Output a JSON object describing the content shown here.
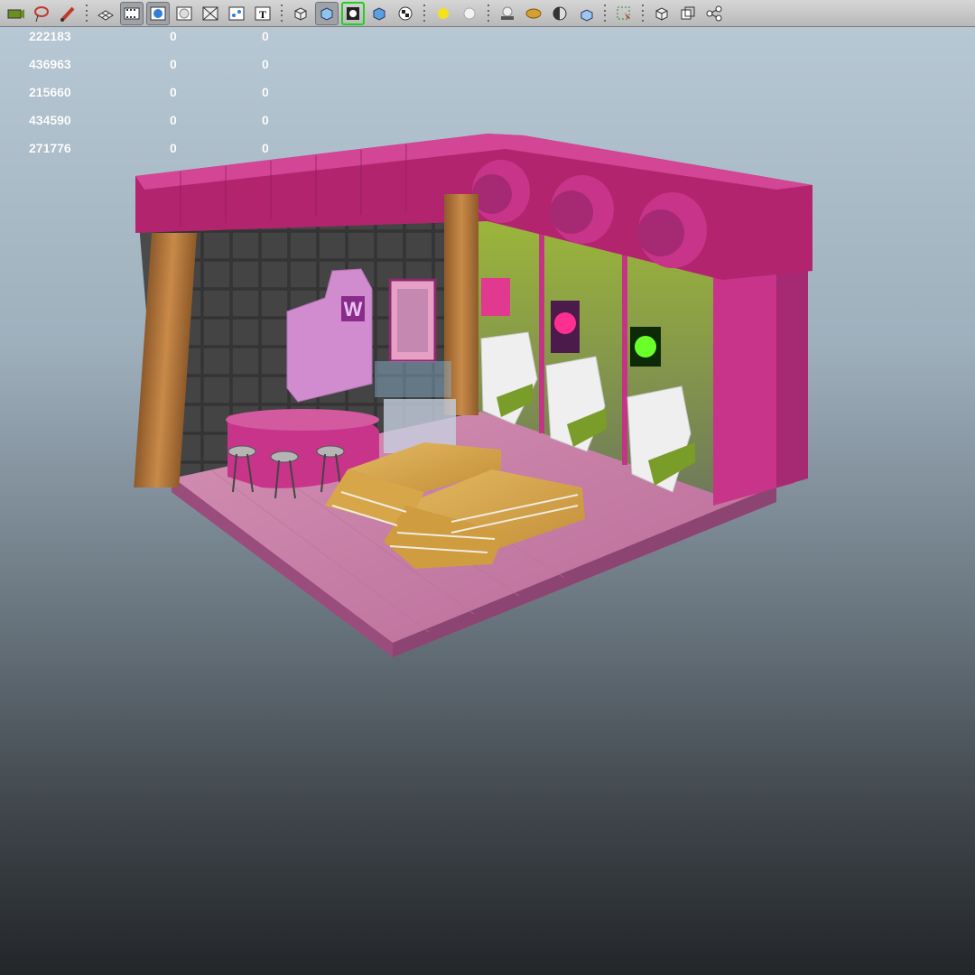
{
  "toolbar": {
    "icons": [
      "select-camera-icon",
      "lasso-tool-icon",
      "paint-brush-icon",
      "grid-toggle-icon",
      "film-gate-icon",
      "smooth-shade-icon",
      "flat-shade-icon",
      "wireframe-icon",
      "isolate-select-icon",
      "text-icon",
      "default-material-icon",
      "textured-icon",
      "xray-joint-icon",
      "xray-icon",
      "checker-icon",
      "use-all-lights-icon",
      "default-light-icon",
      "shadows-icon",
      "ambient-occlusion-icon",
      "motion-blur-icon",
      "antialias-icon",
      "selection-highlight-icon",
      "wireframe-on-shaded-icon",
      "backface-culling-icon",
      "node-graph-icon"
    ],
    "active": [
      "film-gate-icon",
      "smooth-shade-icon",
      "default-material-icon"
    ],
    "selected": "xray-joint-icon"
  },
  "heads_up_display": {
    "rows": [
      {
        "value": "222183",
        "a": "0",
        "b": "0"
      },
      {
        "value": "436963",
        "a": "0",
        "b": "0"
      },
      {
        "value": "215660",
        "a": "0",
        "b": "0"
      },
      {
        "value": "434590",
        "a": "0",
        "b": "0"
      },
      {
        "value": "271776",
        "a": "0",
        "b": "0"
      }
    ]
  },
  "scene": {
    "description_colors": {
      "wall_trim": "#b3246f",
      "floor": "#c77ca3",
      "stage_wood": "#d8ab4e",
      "pillar": "#b8783c",
      "back_wall": "#3a3a3a",
      "booth_wall": "#a6c038",
      "booth_seat": "#e9e9e9"
    }
  }
}
